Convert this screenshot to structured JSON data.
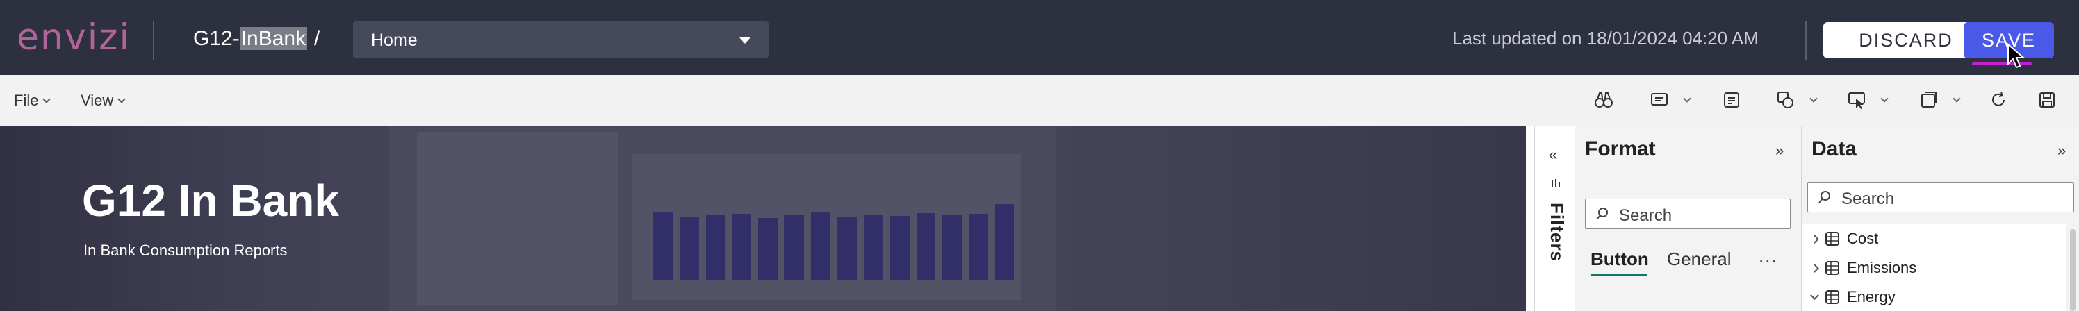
{
  "header": {
    "logo_text": "envizi",
    "title_prefix": "G12-",
    "title_selected": "InBank",
    "title_separator": "/",
    "page_select_value": "Home",
    "last_updated": "Last updated on 18/01/2024 04:20 AM",
    "discard_label": "DISCARD",
    "save_label": "SAVE"
  },
  "menubar": {
    "file_label": "File",
    "view_label": "View",
    "tools": [
      "binoculars-icon",
      "textbox-icon",
      "button-icon",
      "shapes-icon",
      "visual-interaction-icon",
      "pages-icon",
      "refresh-icon",
      "save-icon"
    ]
  },
  "banner": {
    "title": "G12 In Bank",
    "subtitle": "In Bank Consumption Reports"
  },
  "filters_pane": {
    "label": "Filters"
  },
  "format_pane": {
    "title": "Format",
    "search_placeholder": "Search",
    "tabs": [
      {
        "label": "Button",
        "active": true
      },
      {
        "label": "General",
        "active": false
      }
    ],
    "more_label": "..."
  },
  "data_pane": {
    "title": "Data",
    "search_placeholder": "Search",
    "tables": [
      {
        "name": "Cost",
        "expanded": false
      },
      {
        "name": "Emissions",
        "expanded": false
      },
      {
        "name": "Energy",
        "expanded": true
      }
    ]
  },
  "colors": {
    "topbar_bg": "#2d303f",
    "brand": "#b0649a",
    "save_button": "#4a59e8",
    "active_tab_underline": "#117865"
  }
}
